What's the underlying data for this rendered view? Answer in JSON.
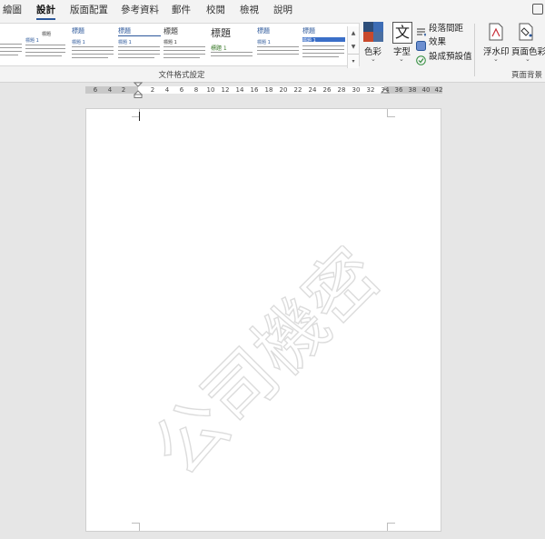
{
  "tabs": [
    "繪圖",
    "設計",
    "版面配置",
    "參考資料",
    "郵件",
    "校閱",
    "檢視",
    "說明"
  ],
  "active_tab": "設計",
  "gallery": {
    "thumbs": [
      {
        "title": "",
        "heading": "標題 1"
      },
      {
        "title": "標題",
        "heading": "標題 1"
      },
      {
        "title": "標題",
        "heading": "標題 1"
      },
      {
        "title": "標題",
        "heading": "標題 1"
      },
      {
        "title": "標題",
        "heading": "標題 1"
      },
      {
        "title": "標題",
        "heading": "標題 1"
      },
      {
        "title": "標題",
        "heading": "標題 1"
      },
      {
        "title": "標題",
        "heading": "標題 1"
      }
    ],
    "group_label": "文件格式設定"
  },
  "colors_label": "色彩",
  "fonts_label": "字型",
  "fonts_glyph": "文",
  "paragraph_spacing_label": "段落間距",
  "effects_label": "效果",
  "set_default_label": "設成預設值",
  "watermark_label": "浮水印",
  "page_color_label": "頁面色彩",
  "page_background_group": "頁面背景",
  "ruler_labels": [
    "6",
    "4",
    "2",
    "2",
    "4",
    "6",
    "8",
    "10",
    "12",
    "14",
    "16",
    "18",
    "20",
    "22",
    "24",
    "26",
    "28",
    "30",
    "32",
    "34",
    "36",
    "38",
    "40",
    "42"
  ],
  "watermark_text": "公司機密",
  "colors": {
    "accent": "#2b579a",
    "watermark": "#e3e3e3",
    "ribbon_bg": "#f3f3f3",
    "page_bg": "#ffffff"
  }
}
